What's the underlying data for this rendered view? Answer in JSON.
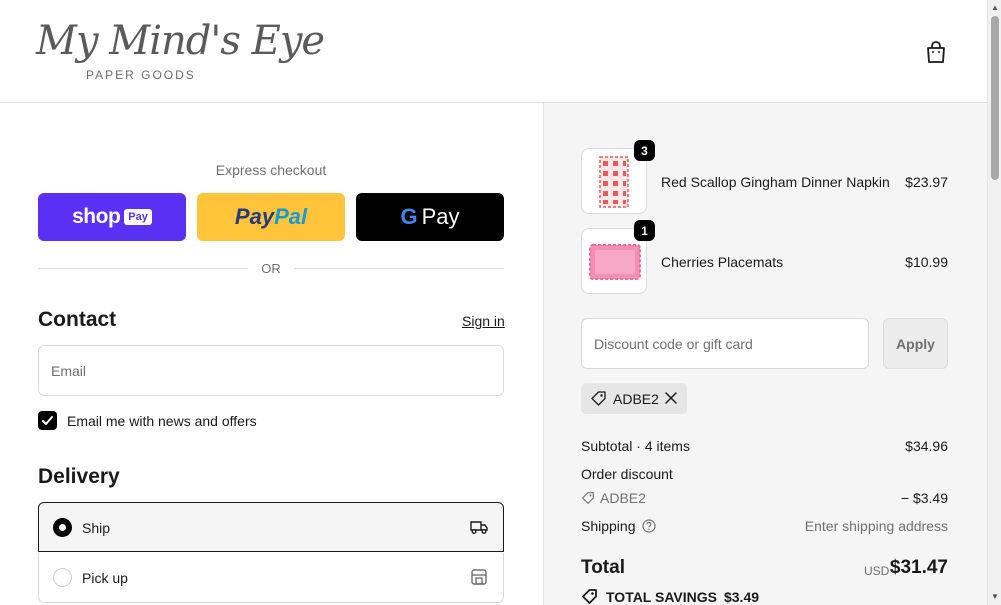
{
  "store": {
    "logo_script": "My Mind's Eye",
    "logo_sub": "PAPER GOODS"
  },
  "icons": {
    "cart": "shopping-bag-icon",
    "ship": "truck-icon",
    "pickup": "store-icon",
    "tag": "tag-icon",
    "remove": "close-icon",
    "help": "question-circle-icon",
    "check": "checkmark-icon"
  },
  "express": {
    "title": "Express checkout",
    "shop_pay_word": "shop",
    "shop_pay_box": "Pay",
    "paypal_part1": "Pay",
    "paypal_part2": "Pal",
    "gpay_g": "G",
    "gpay_word": "Pay",
    "or": "OR"
  },
  "contact": {
    "heading": "Contact",
    "sign_in": "Sign in",
    "email_placeholder": "Email",
    "newsletter_label": "Email me with news and offers",
    "newsletter_checked": true
  },
  "delivery": {
    "heading": "Delivery",
    "options": [
      {
        "label": "Ship",
        "selected": true
      },
      {
        "label": "Pick up",
        "selected": false
      }
    ]
  },
  "cart": {
    "items": [
      {
        "name": "Red Scallop Gingham Dinner Napkin",
        "qty": "3",
        "price": "$23.97"
      },
      {
        "name": "Cherries Placemats",
        "qty": "1",
        "price": "$10.99"
      }
    ]
  },
  "discount": {
    "placeholder": "Discount code or gift card",
    "apply": "Apply",
    "applied_code": "ADBE2"
  },
  "summary": {
    "subtotal_label": "Subtotal · 4 items",
    "subtotal_value": "$34.96",
    "order_discount_label": "Order discount",
    "order_discount_code": "ADBE2",
    "order_discount_value": "− $3.49",
    "shipping_label": "Shipping",
    "shipping_value": "Enter shipping address",
    "total_label": "Total",
    "currency": "USD",
    "total_value": "$31.47",
    "savings_label": "TOTAL SAVINGS",
    "savings_value": "$3.49"
  },
  "colors": {
    "shop_pay": "#5a31f4",
    "paypal": "#ffc439",
    "gpay": "#000000",
    "summary_bg": "#f5f5f5"
  }
}
